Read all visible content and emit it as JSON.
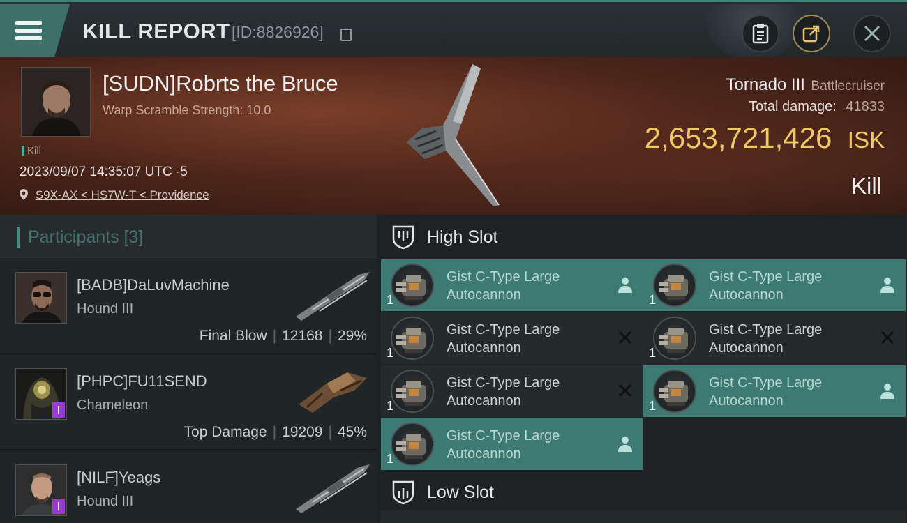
{
  "header": {
    "title": "KILL REPORT",
    "report_id": "[ID:8826926]"
  },
  "victim": {
    "name": "[SUDN]Robrts the Bruce",
    "scramble": "Warp Scramble Strength: 10.0",
    "tag": "Kill",
    "datetime": "2023/09/07 14:35:07 UTC -5",
    "location": "S9X-AX < HS7W-T < Providence",
    "ship_name": "Tornado III",
    "ship_class": "Battlecruiser",
    "damage_label": "Total damage:",
    "damage_value": "41833",
    "isk_value": "2,653,721,426",
    "isk_unit": "ISK",
    "result": "Kill"
  },
  "participants": {
    "label": "Participants [3]",
    "rows": [
      {
        "name": "[BADB]DaLuvMachine",
        "ship": "Hound III",
        "role": "Final Blow",
        "damage": "12168",
        "percent": "29%",
        "badge": false
      },
      {
        "name": "[PHPC]FU11SEND",
        "ship": "Chameleon",
        "role": "Top Damage",
        "damage": "19209",
        "percent": "45%",
        "badge": true
      },
      {
        "name": "[NILF]Yeags",
        "ship": "Hound III",
        "role": "",
        "damage": "",
        "percent": "",
        "badge": true
      }
    ]
  },
  "slots": {
    "high_label": "High Slot",
    "low_label": "Low Slot",
    "high_modules": [
      {
        "line1": "Gist C-Type Large",
        "line2": "Autocannon",
        "qty": "1",
        "status": "fitted"
      },
      {
        "line1": "Gist C-Type Large",
        "line2": "Autocannon",
        "qty": "1",
        "status": "fitted"
      },
      {
        "line1": "Gist C-Type Large",
        "line2": "Autocannon",
        "qty": "1",
        "status": "destroyed"
      },
      {
        "line1": "Gist C-Type Large",
        "line2": "Autocannon",
        "qty": "1",
        "status": "destroyed"
      },
      {
        "line1": "Gist C-Type Large",
        "line2": "Autocannon",
        "qty": "1",
        "status": "destroyed"
      },
      {
        "line1": "Gist C-Type Large",
        "line2": "Autocannon",
        "qty": "1",
        "status": "fitted"
      },
      {
        "line1": "Gist C-Type Large",
        "line2": "Autocannon",
        "qty": "1",
        "status": "fitted"
      }
    ]
  },
  "colors": {
    "accent_teal": "#3c7a73",
    "isk_gold": "#f0c865",
    "banner_red": "#4a2419",
    "badge_purple": "#9a3cd4"
  },
  "icons": [
    "menu-icon",
    "copy-icon",
    "clipboard-icon",
    "share-icon",
    "close-icon",
    "location-pin-icon",
    "shield-slot-icon",
    "person-icon",
    "x-icon"
  ]
}
